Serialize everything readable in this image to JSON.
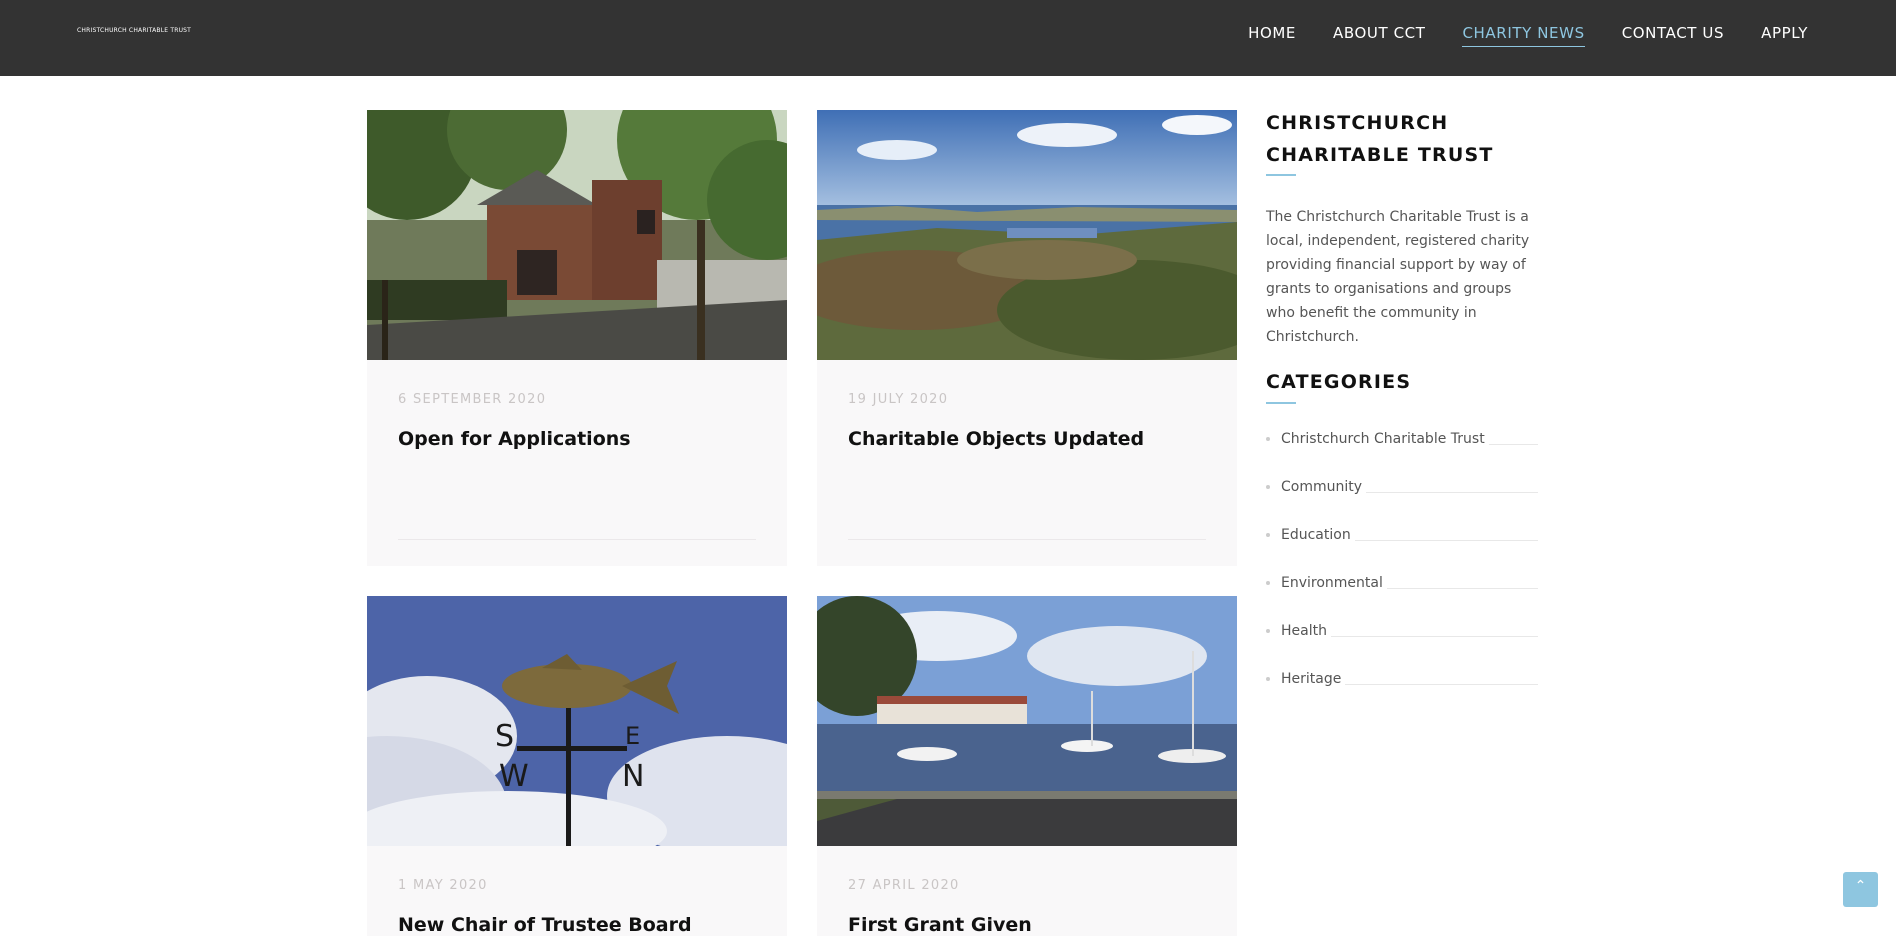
{
  "header": {
    "logo_text": "CHRISTCHURCH CHARITABLE TRUST",
    "nav": [
      {
        "label": "HOME",
        "active": false
      },
      {
        "label": "ABOUT CCT",
        "active": false
      },
      {
        "label": "CHARITY NEWS",
        "active": true
      },
      {
        "label": "CONTACT US",
        "active": false
      },
      {
        "label": "APPLY",
        "active": false
      }
    ]
  },
  "posts": [
    {
      "date": "6 SEPTEMBER 2020",
      "title": "Open for Applications",
      "image": "old-mill-photo"
    },
    {
      "date": "19 JULY 2020",
      "title": "Charitable Objects Updated",
      "image": "harbour-landscape-photo"
    },
    {
      "date": "1 MAY 2020",
      "title": "New Chair of Trustee Board",
      "image": "salmon-weathervane-photo"
    },
    {
      "date": "27 APRIL 2020",
      "title": "First Grant Given",
      "image": "quay-boats-photo"
    }
  ],
  "sidebar": {
    "about_title": "CHRISTCHURCH CHARITABLE TRUST",
    "about_text": "The Christchurch Charitable Trust is a local, independent, registered charity providing financial support by way of grants to organisations and groups who benefit the community in Christchurch.",
    "categories_title": "CATEGORIES",
    "categories": [
      "Christchurch Charitable Trust",
      "Community",
      "Education",
      "Environmental",
      "Health",
      "Heritage"
    ]
  },
  "back_to_top": {
    "icon": "chevron-up-icon",
    "glyph": "⌃"
  },
  "colors": {
    "header_bg": "#333333",
    "accent": "#8ec6e0",
    "card_bg": "#f9f8f9"
  }
}
